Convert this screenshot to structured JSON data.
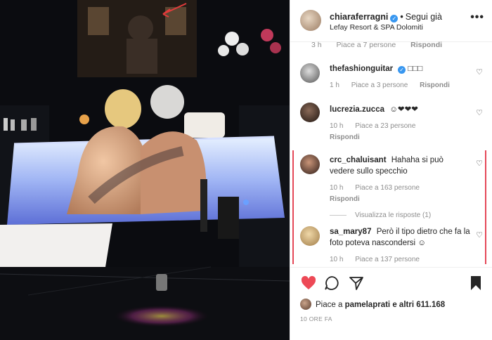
{
  "header": {
    "username": "chiaraferragni",
    "follow_label": "Segui già",
    "location": "Lefay Resort & SPA Dolomiti",
    "more_label": "•••"
  },
  "top_meta": {
    "time": "3 h",
    "likes": "Piace a 7 persone",
    "reply": "Rispondi"
  },
  "comments": [
    {
      "username": "thefashionguitar",
      "verified": true,
      "text": "□□□",
      "time": "1 h",
      "likes": "Piace a 3 persone",
      "reply": "Rispondi"
    },
    {
      "username": "lucrezia.zucca",
      "text": "☺❤❤❤",
      "time": "10 h",
      "likes": "Piace a 23 persone",
      "reply": "Rispondi"
    },
    {
      "username": "crc_chaluisant",
      "text": "Hahaha si può vedere sullo specchio",
      "time": "10 h",
      "likes": "Piace a 163 persone",
      "reply": "Rispondi",
      "view_replies": "Visualizza le risposte (1)"
    },
    {
      "username": "sa_mary87",
      "text": "Però il tipo dietro che fa la foto poteva nascondersi ☺",
      "time": "10 h",
      "likes": "Piace a 137 persone"
    }
  ],
  "likes_summary": {
    "prefix": "Piace a",
    "user": "pamelaprati",
    "suffix": "e altri 611.168"
  },
  "time_ago": "10 ORE FA",
  "colors": {
    "verified": "#3897f0",
    "like_red": "#ed4956",
    "annotation_red": "#e54858",
    "muted": "#8e8e8e"
  }
}
